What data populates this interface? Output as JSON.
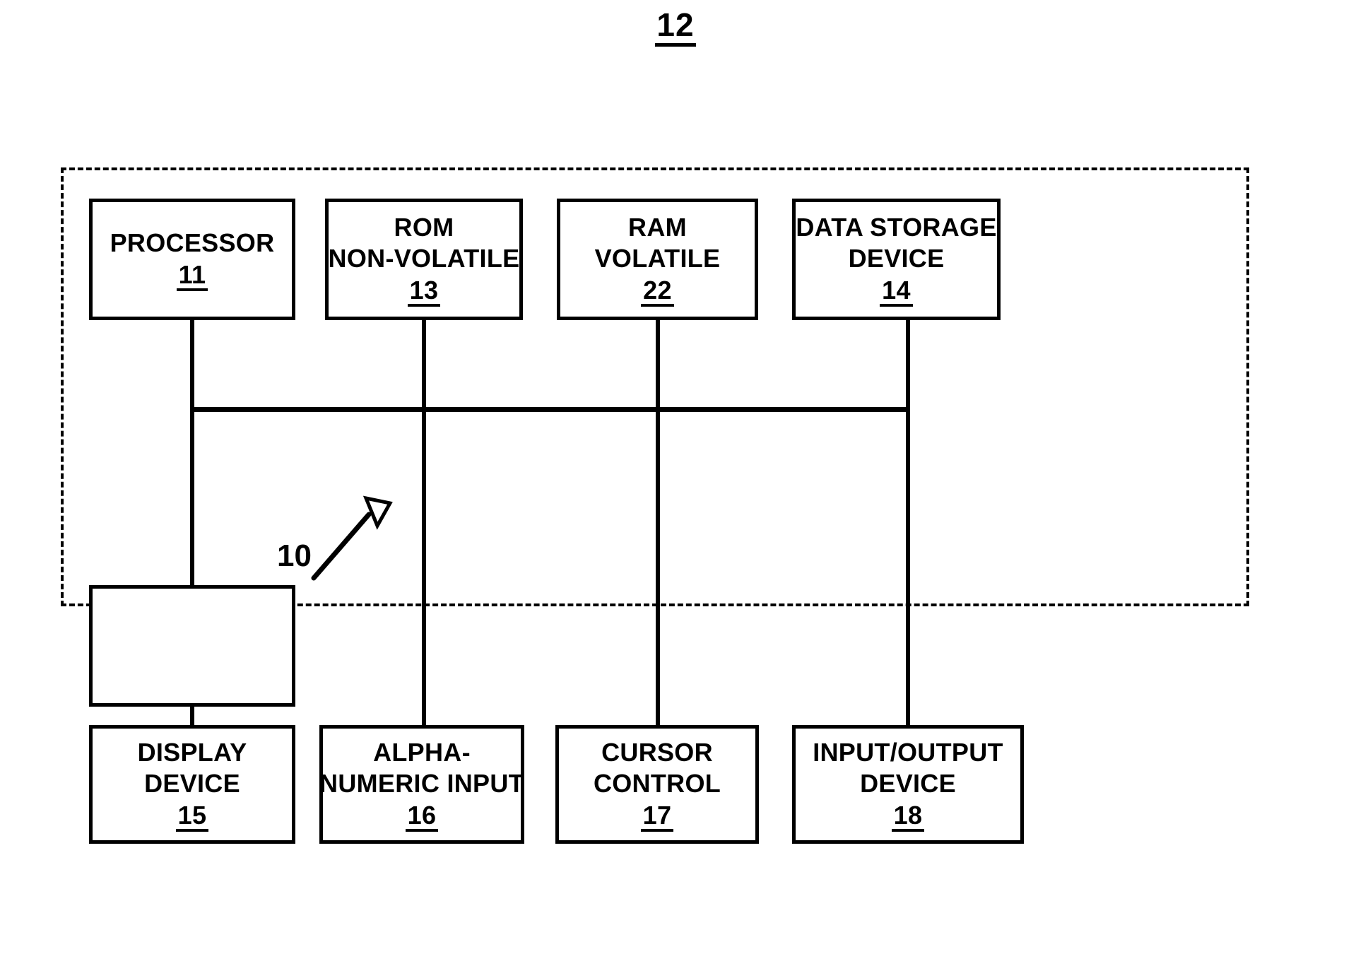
{
  "figure": {
    "number": "12",
    "system_bus_label": "10"
  },
  "enclosure": {
    "name": "computer-system-boundary",
    "style": "dashed"
  },
  "blocks": {
    "top_row": [
      {
        "id": "processor",
        "lines": [
          "PROCESSOR"
        ],
        "refnum": "11"
      },
      {
        "id": "rom-non-volatile",
        "lines": [
          "ROM",
          "NON-VOLATILE"
        ],
        "refnum": "13"
      },
      {
        "id": "ram-volatile",
        "lines": [
          "RAM",
          "VOLATILE"
        ],
        "refnum": "22"
      },
      {
        "id": "data-storage-device",
        "lines": [
          "DATA STORAGE",
          "DEVICE"
        ],
        "refnum": "14"
      }
    ],
    "bottom_row": [
      {
        "id": "display-device",
        "lines": [
          "DISPLAY",
          "DEVICE"
        ],
        "refnum": "15"
      },
      {
        "id": "alphanumeric-input",
        "lines": [
          "ALPHA-",
          "NUMERIC INPUT"
        ],
        "refnum": "16"
      },
      {
        "id": "cursor-control",
        "lines": [
          "CURSOR",
          "CONTROL"
        ],
        "refnum": "17"
      },
      {
        "id": "input-output-device",
        "lines": [
          "INPUT/OUTPUT",
          "DEVICE"
        ],
        "refnum": "18"
      }
    ]
  },
  "colors": {
    "ink": "#000000",
    "paper": "#ffffff"
  }
}
